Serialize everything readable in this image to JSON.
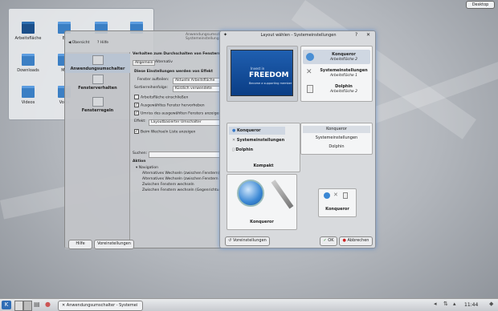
{
  "desktop": {
    "button": "Desktop",
    "folders": [
      "Arbeitsfläche",
      "Bi",
      "",
      "",
      "Downloads",
      "Mu",
      "",
      "",
      "Videos",
      "Vorla",
      "",
      ""
    ]
  },
  "bg_window": {
    "title": "Anwendungsumschalter - Systemeinstellungen",
    "toolbar_overview": "Übersicht",
    "toolbar_help": "Hilfe",
    "side_items": [
      "Anwendungsumschalter",
      "Fensterverhalten",
      "Fensterregeln"
    ],
    "heading": "Verhalten zum Durchschalten von Fenstern",
    "tabs": [
      "Allgemein",
      "Alternativ"
    ],
    "section": "Diese Einstellungen werden von Effekt",
    "row_windows_label": "Fenster aufteilen:",
    "row_windows_value": "Aktuelle Arbeitsfläche",
    "row_order_label": "Sortierreihenfolge:",
    "row_order_value": "Kürzlich verwendete",
    "checks": [
      "Arbeitsfläche einschließen",
      "Ausgewähltes Fenster hervorheben",
      "Umriss des ausgewählten Fensters anzeigen"
    ],
    "effect_label": "Effekt:",
    "effect_value": "Layoutbasierter Umschalter",
    "check_popup": "Beim Wechseln Liste anzeigen",
    "search_label": "Suchen:",
    "action_label": "Aktion",
    "tree_root": "Navigation",
    "tree_items": [
      "Alternatives Wechseln (zwischen Fenstern)",
      "Alternatives Wechseln (zwischen Fenstern",
      "Zwischen Fenstern wechseln",
      "Zwischen Fenstern wechseln (Gegenrichtung)"
    ],
    "btn_help": "Hilfe",
    "btn_defaults": "Voreinstellungen"
  },
  "dialog": {
    "title": "Layout wählen - Systemeinstellungen",
    "preview_text": "FREEDOM",
    "preview_sub": "Invest in",
    "preview_sub2": "Become a supporting member",
    "big_list": [
      {
        "name": "Konqueror",
        "desc": "Arbeitsfläche 2"
      },
      {
        "name": "Systemeinstellungen",
        "desc": "Arbeitsfläche 1"
      },
      {
        "name": "Dolphin",
        "desc": "Arbeitsfläche 2"
      }
    ],
    "compact_list": [
      "Konqueror",
      "Systemeinstellungen",
      "Dolphin"
    ],
    "compact_label": "Kompakt",
    "text_list": [
      "Konqueror",
      "Systemeinstellungen",
      "Dolphin"
    ],
    "big_icon_label": "Konqueror",
    "small_icons_label": "Konqueror",
    "btn_defaults": "Voreinstellungen",
    "btn_ok": "OK",
    "btn_cancel": "Abbrechen"
  },
  "taskbar": {
    "task_label": "Anwendungsumschalter - Systemei",
    "clock": "11:44"
  }
}
